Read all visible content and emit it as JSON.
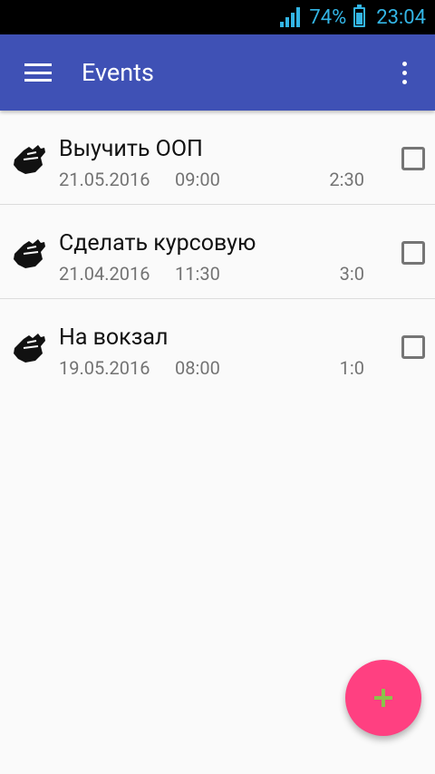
{
  "status_bar": {
    "battery": "74%",
    "time": "23:04",
    "color": "#33b5e5"
  },
  "app_bar": {
    "title": "Events",
    "color": "#3f51b5",
    "menu_icon": "hamburger-menu-icon",
    "overflow_icon": "more-vert-icon"
  },
  "events": [
    {
      "title": "Выучить ООП",
      "date": "21.05.2016",
      "time": "09:00",
      "duration": "2:30",
      "checked": false
    },
    {
      "title": "Сделать курсовую",
      "date": "21.04.2016",
      "time": "11:30",
      "duration": "3:0",
      "checked": false
    },
    {
      "title": "На вокзал",
      "date": "19.05.2016",
      "time": "08:00",
      "duration": "1:0",
      "checked": false
    }
  ],
  "fab": {
    "icon": "plus-icon",
    "color": "#ff4081",
    "icon_color": "#8bc34a"
  }
}
